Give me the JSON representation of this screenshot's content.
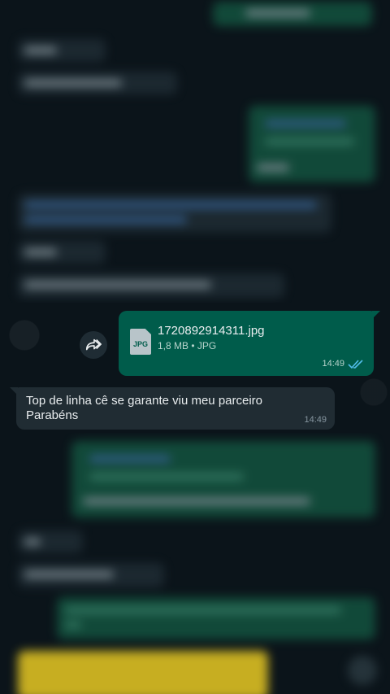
{
  "chat": {
    "forwarded_document": {
      "file_name": "1720892914311.jpg",
      "file_ext": "JPG",
      "file_meta": "1,8 MB • JPG",
      "time": "14:49",
      "status_icon": "double-check-read-icon"
    },
    "incoming_message": {
      "text": "Top de linha cê se garante viu meu parceiro\nParabéns",
      "time": "14:49"
    }
  },
  "colors": {
    "background": "#0b141a",
    "outgoing_bubble": "#005c4b",
    "incoming_bubble": "#202c33",
    "read_ticks": "#53bdeb"
  },
  "icons": {
    "forward": "forward-arrow-icon",
    "file": "file-icon"
  }
}
